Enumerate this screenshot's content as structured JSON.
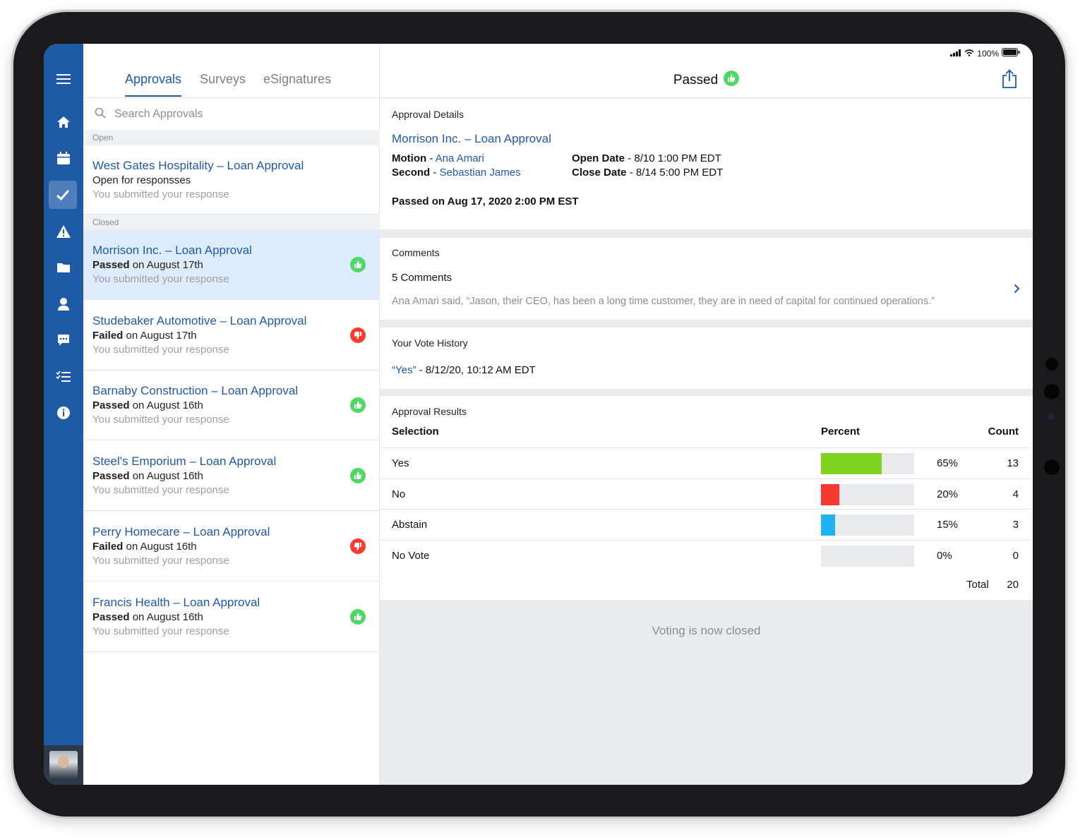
{
  "sidebar": {
    "icons": [
      "menu-icon",
      "home-icon",
      "calendar-icon",
      "checkmark-icon",
      "warning-icon",
      "folder-icon",
      "person-icon",
      "chat-icon",
      "checklist-icon",
      "info-icon"
    ]
  },
  "tabs": [
    "Approvals",
    "Surveys",
    "eSignatures"
  ],
  "search": {
    "placeholder": "Search Approvals"
  },
  "sections": {
    "open": "Open",
    "closed": "Closed"
  },
  "open_items": [
    {
      "title": "West Gates Hospitality – Loan Approval",
      "status_bold": "",
      "status_rest": "Open for responsses",
      "sub": "You submitted your response"
    }
  ],
  "closed_items": [
    {
      "title": "Morrison Inc. – Loan Approval",
      "status_bold": "Passed",
      "status_rest": " on August 17th",
      "sub": "You submitted your response",
      "result": "pass"
    },
    {
      "title": "Studebaker Automotive – Loan Approval",
      "status_bold": "Failed",
      "status_rest": " on August 17th",
      "sub": "You submitted your response",
      "result": "fail"
    },
    {
      "title": "Barnaby Construction – Loan Approval",
      "status_bold": "Passed",
      "status_rest": " on August 16th",
      "sub": "You submitted your response",
      "result": "pass"
    },
    {
      "title": "Steel's Emporium  – Loan Approval",
      "status_bold": "Passed",
      "status_rest": " on August 16th",
      "sub": "You submitted your response",
      "result": "pass"
    },
    {
      "title": "Perry Homecare – Loan Approval",
      "status_bold": "Failed",
      "status_rest": " on August 16th",
      "sub": "You submitted your response",
      "result": "fail"
    },
    {
      "title": "Francis Health  – Loan Approval",
      "status_bold": "Passed",
      "status_rest": " on August 16th",
      "sub": "You submitted your response",
      "result": "pass"
    }
  ],
  "status_bar": {
    "battery": "100%"
  },
  "detail": {
    "title": "Passed",
    "approval_details": {
      "label": "Approval Details",
      "name": "Morrison Inc. – Loan Approval",
      "motion_label": "Motion",
      "motion_name": "Ana Amari",
      "second_label": "Second",
      "second_name": "Sebastian James",
      "open_label": "Open Date",
      "open_value": "8/10 1:00 PM EDT",
      "close_label": "Close Date",
      "close_value": "8/14 5:00 PM EDT",
      "passed_on": "Passed on Aug 17, 2020 2:00 PM EST"
    },
    "comments": {
      "label": "Comments",
      "count": "5 Comments",
      "preview": "Ana Amari said, “Jason, their CEO, has been a long time customer, they are in need of capital for continued operations.”"
    },
    "vote_history": {
      "label": "Your Vote History",
      "vote": "“Yes”",
      "when": " - 8/12/20, 10:12 AM EDT"
    },
    "results": {
      "label": "Approval Results",
      "col_selection": "Selection",
      "col_percent": "Percent",
      "col_count": "Count",
      "rows": [
        {
          "selection": "Yes",
          "percent_value": 65,
          "percent": "65%",
          "count": "13",
          "color": "#7ed321"
        },
        {
          "selection": "No",
          "percent_value": 20,
          "percent": "20%",
          "count": "4",
          "color": "#f5392e"
        },
        {
          "selection": "Abstain",
          "percent_value": 15,
          "percent": "15%",
          "count": "3",
          "color": "#1fb2f5"
        },
        {
          "selection": "No Vote",
          "percent_value": 0,
          "percent": "0%",
          "count": "0",
          "color": "#cccccc"
        }
      ],
      "total_label": "Total",
      "total_value": "20"
    },
    "closed_message": "Voting is now closed"
  },
  "colors": {
    "brand": "#1e5aa6",
    "pass": "#4cd964",
    "fail": "#ff3b30"
  }
}
